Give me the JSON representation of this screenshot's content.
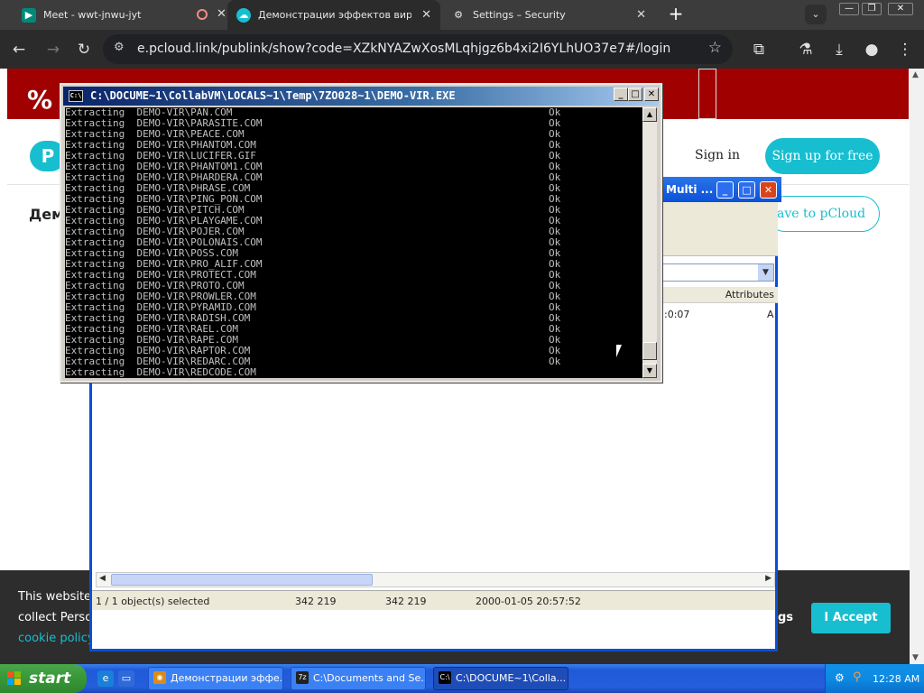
{
  "browser": {
    "tabs": [
      {
        "title": "Meet - wwt-jnwu-jyt",
        "icon": "meet-icon",
        "indicator": "recording-icon"
      },
      {
        "title": "Демонстрации эффектов вирусов",
        "icon": "pcloud-icon"
      },
      {
        "title": "Settings – Security",
        "icon": "gear-icon"
      }
    ],
    "url": "e.pcloud.link/publink/show?code=XZkNYAZwXosMLqhjgz6b4xi2I6YLhUO37e7#/login"
  },
  "page": {
    "percent_logo": "%",
    "sign_in": "Sign in",
    "sign_up": "Sign up for free",
    "heading_partial": "Дем",
    "save_partial": "ave to pCloud",
    "cookie": {
      "line1": "This website",
      "line2": "collect Perso",
      "line3": "cookie policy",
      "settings_partial": "gs",
      "accept": "I Accept"
    }
  },
  "explorer": {
    "title_partial": "Multi ...",
    "column_attributes": "Attributes",
    "cell_time_partial": ":0:07",
    "cell_attr": "A",
    "status": {
      "selected": "1 / 1 object(s) selected",
      "size1": "342 219",
      "size2": "342 219",
      "modified": "2000-01-05 20:57:52"
    }
  },
  "console": {
    "title": "C:\\DOCUME~1\\CollabVM\\LOCALS~1\\Temp\\7ZO028~1\\DEMO-VIR.EXE",
    "icon_label": "C:\\",
    "lines": [
      {
        "prefix": "Extracting",
        "file": "DEMO-VIR\\PAN.COM",
        "status": "Ok"
      },
      {
        "prefix": "Extracting",
        "file": "DEMO-VIR\\PARASITE.COM",
        "status": "Ok"
      },
      {
        "prefix": "Extracting",
        "file": "DEMO-VIR\\PEACE.COM",
        "status": "Ok"
      },
      {
        "prefix": "Extracting",
        "file": "DEMO-VIR\\PHANTOM.COM",
        "status": "Ok"
      },
      {
        "prefix": "Extracting",
        "file": "DEMO-VIR\\LUCIFER.GIF",
        "status": "Ok"
      },
      {
        "prefix": "Extracting",
        "file": "DEMO-VIR\\PHANTOM1.COM",
        "status": "Ok"
      },
      {
        "prefix": "Extracting",
        "file": "DEMO-VIR\\PHARDERA.COM",
        "status": "Ok"
      },
      {
        "prefix": "Extracting",
        "file": "DEMO-VIR\\PHRASE.COM",
        "status": "Ok"
      },
      {
        "prefix": "Extracting",
        "file": "DEMO-VIR\\PING_PON.COM",
        "status": "Ok"
      },
      {
        "prefix": "Extracting",
        "file": "DEMO-VIR\\PITCH.COM",
        "status": "Ok"
      },
      {
        "prefix": "Extracting",
        "file": "DEMO-VIR\\PLAYGAME.COM",
        "status": "Ok"
      },
      {
        "prefix": "Extracting",
        "file": "DEMO-VIR\\POJER.COM",
        "status": "Ok"
      },
      {
        "prefix": "Extracting",
        "file": "DEMO-VIR\\POLONAIS.COM",
        "status": "Ok"
      },
      {
        "prefix": "Extracting",
        "file": "DEMO-VIR\\POSS.COM",
        "status": "Ok"
      },
      {
        "prefix": "Extracting",
        "file": "DEMO-VIR\\PRO_ALIF.COM",
        "status": "Ok"
      },
      {
        "prefix": "Extracting",
        "file": "DEMO-VIR\\PROTECT.COM",
        "status": "Ok"
      },
      {
        "prefix": "Extracting",
        "file": "DEMO-VIR\\PROTO.COM",
        "status": "Ok"
      },
      {
        "prefix": "Extracting",
        "file": "DEMO-VIR\\PROWLER.COM",
        "status": "Ok"
      },
      {
        "prefix": "Extracting",
        "file": "DEMO-VIR\\PYRAMID.COM",
        "status": "Ok"
      },
      {
        "prefix": "Extracting",
        "file": "DEMO-VIR\\RADISH.COM",
        "status": "Ok"
      },
      {
        "prefix": "Extracting",
        "file": "DEMO-VIR\\RAEL.COM",
        "status": "Ok"
      },
      {
        "prefix": "Extracting",
        "file": "DEMO-VIR\\RAPE.COM",
        "status": "Ok"
      },
      {
        "prefix": "Extracting",
        "file": "DEMO-VIR\\RAPTOR.COM",
        "status": "Ok"
      },
      {
        "prefix": "Extracting",
        "file": "DEMO-VIR\\REDARC.COM",
        "status": "Ok"
      },
      {
        "prefix": "Extracting",
        "file": "DEMO-VIR\\REDCODE.COM",
        "status": ""
      }
    ]
  },
  "taskbar": {
    "start": "start",
    "buttons": [
      {
        "label": "Демонстрации эффе...",
        "icon": "browser-icon"
      },
      {
        "label": "C:\\Documents and Se...",
        "icon": "7zip-icon"
      },
      {
        "label": "C:\\DOCUME~1\\Colla...",
        "icon": "console-icon"
      }
    ],
    "clock": "12:28 AM"
  }
}
